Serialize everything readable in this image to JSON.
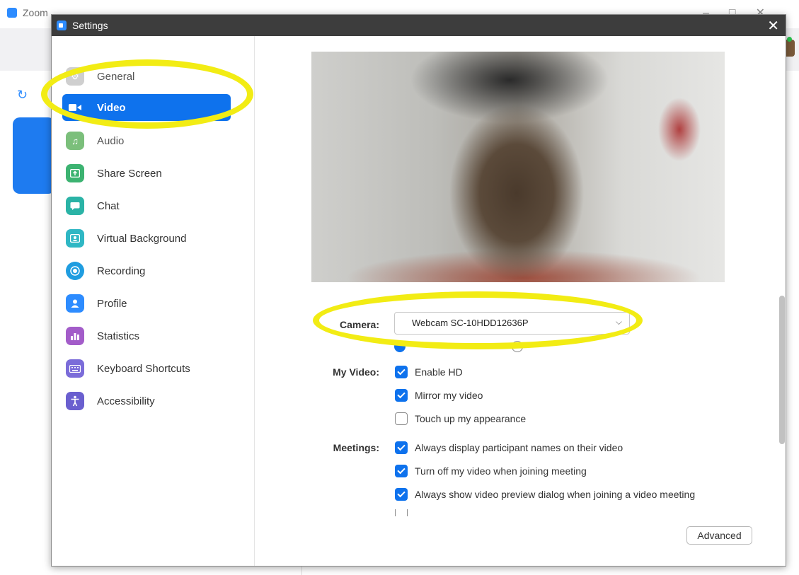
{
  "background_app": {
    "title": "Zoom"
  },
  "dialog": {
    "title": "Settings",
    "close_glyph": "✕"
  },
  "sidebar": {
    "items": [
      {
        "label": "General",
        "icon": "gear-icon",
        "color": "#c8c8c8"
      },
      {
        "label": "Video",
        "icon": "video-camera-icon",
        "color": "#0e72ed",
        "active": true
      },
      {
        "label": "Audio",
        "icon": "headphones-icon",
        "color": "#7bbf7b"
      },
      {
        "label": "Share Screen",
        "icon": "share-screen-icon",
        "color": "#3cb371"
      },
      {
        "label": "Chat",
        "icon": "chat-bubble-icon",
        "color": "#2ab3a6"
      },
      {
        "label": "Virtual Background",
        "icon": "virtual-background-icon",
        "color": "#2fb7c4"
      },
      {
        "label": "Recording",
        "icon": "record-icon",
        "color": "#1f9de0"
      },
      {
        "label": "Profile",
        "icon": "person-icon",
        "color": "#2d8cff"
      },
      {
        "label": "Statistics",
        "icon": "bar-chart-icon",
        "color": "#a35cc9"
      },
      {
        "label": "Keyboard Shortcuts",
        "icon": "keyboard-icon",
        "color": "#7b6cd9"
      },
      {
        "label": "Accessibility",
        "icon": "accessibility-icon",
        "color": "#6a5fcf"
      }
    ]
  },
  "camera": {
    "label": "Camera:",
    "selected": "Webcam SC-10HDD12636P"
  },
  "my_video": {
    "label": "My Video:",
    "options": [
      {
        "label": "Enable HD",
        "checked": true
      },
      {
        "label": "Mirror my video",
        "checked": true
      },
      {
        "label": "Touch up my appearance",
        "checked": false
      }
    ]
  },
  "meetings": {
    "label": "Meetings:",
    "options": [
      {
        "label": "Always display participant names on their video",
        "checked": true
      },
      {
        "label": "Turn off my video when joining meeting",
        "checked": true
      },
      {
        "label": "Always show video preview dialog when joining a video meeting",
        "checked": true
      }
    ]
  },
  "advanced_button": {
    "label": "Advanced"
  },
  "colors": {
    "accent": "#0e72ed",
    "highlight": "#f2ec14",
    "titlebar": "#3d3d3d"
  }
}
